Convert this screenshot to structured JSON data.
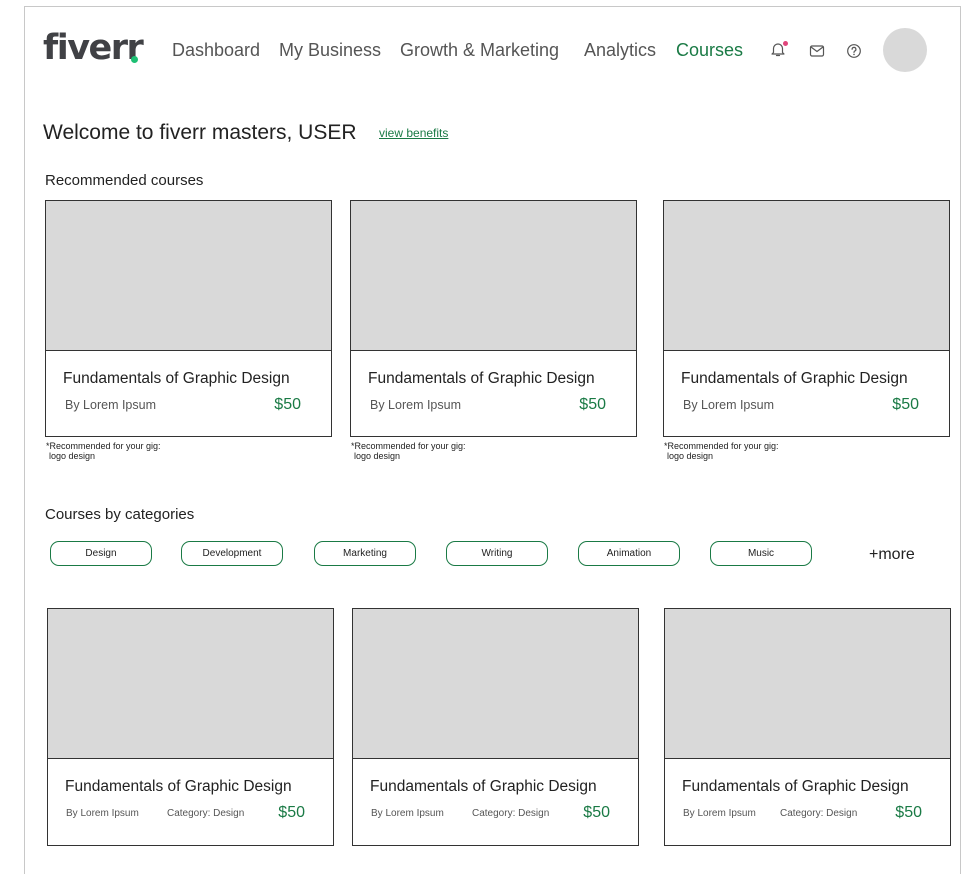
{
  "header": {
    "logo": "fiverr",
    "nav": [
      {
        "label": "Dashboard"
      },
      {
        "label": "My Business"
      },
      {
        "label": "Growth & Marketing"
      },
      {
        "label": "Analytics"
      },
      {
        "label": "Courses"
      }
    ],
    "active_nav": "Courses",
    "icons": [
      "bell-icon",
      "mail-icon",
      "help-icon"
    ],
    "brand_color": "#1dbf73",
    "accent_color": "#1a7a45",
    "notification_color": "#e0457b"
  },
  "welcome": {
    "text": "Welcome to fiverr masters, USER",
    "link": "view benefits"
  },
  "recommended": {
    "title": "Recommended courses",
    "cards": [
      {
        "title": "Fundamentals of Graphic Design",
        "author": "By Lorem Ipsum",
        "price": "$50",
        "note1": "*Recommended for your gig:",
        "note2": "logo design"
      },
      {
        "title": "Fundamentals of Graphic Design",
        "author": "By Lorem Ipsum",
        "price": "$50",
        "note1": "*Recommended for your gig:",
        "note2": "logo design"
      },
      {
        "title": "Fundamentals of Graphic Design",
        "author": "By Lorem Ipsum",
        "price": "$50",
        "note1": "*Recommended for your gig:",
        "note2": "logo design"
      }
    ]
  },
  "categories": {
    "title": "Courses by categories",
    "chips": [
      {
        "label": "Design"
      },
      {
        "label": "Development"
      },
      {
        "label": "Marketing"
      },
      {
        "label": "Writing"
      },
      {
        "label": "Animation"
      },
      {
        "label": "Music"
      }
    ],
    "more": "+more",
    "cards": [
      {
        "title": "Fundamentals of Graphic Design",
        "author": "By Lorem Ipsum",
        "category": "Category: Design",
        "price": "$50"
      },
      {
        "title": "Fundamentals of Graphic Design",
        "author": "By Lorem Ipsum",
        "category": "Category: Design",
        "price": "$50"
      },
      {
        "title": "Fundamentals of Graphic Design",
        "author": "By Lorem Ipsum",
        "category": "Category: Design",
        "price": "$50"
      }
    ]
  }
}
